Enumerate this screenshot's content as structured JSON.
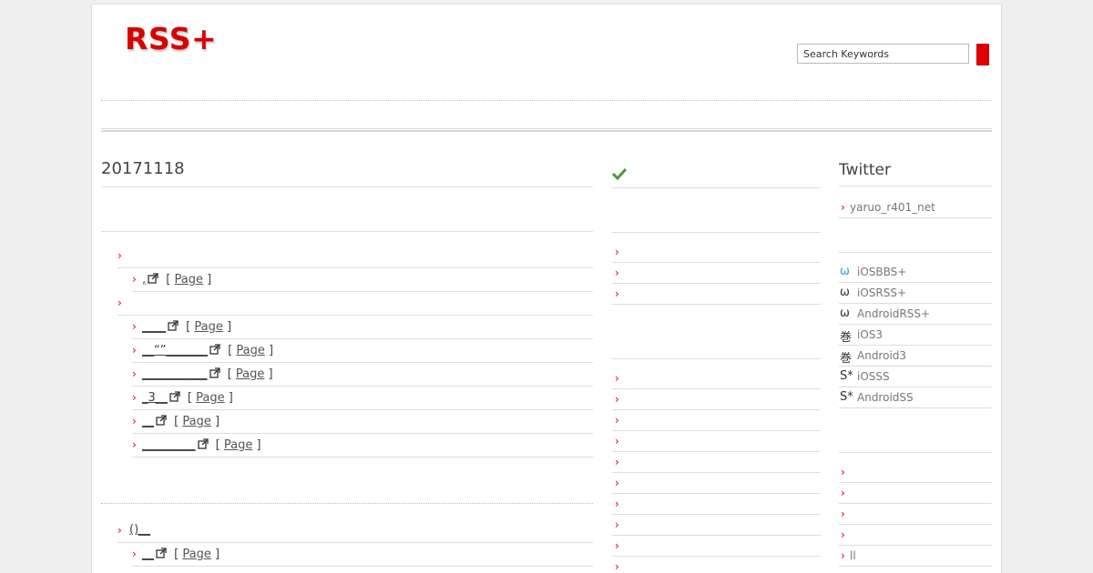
{
  "header": {
    "logo": "RSS+",
    "search_value": "Search Keywords"
  },
  "main": {
    "post_title": "20171118",
    "groups": [
      {
        "label": "",
        "items": [
          {
            "title": "",
            "page_label": "Page"
          }
        ]
      },
      {
        "label": "",
        "items": [
          {
            "title": "____",
            "page_label": "Page"
          },
          {
            "title": "__“”_______",
            "page_label": "Page"
          },
          {
            "title": "___________",
            "page_label": "Page"
          },
          {
            "title": "_3__",
            "page_label": "Page"
          },
          {
            "title": "__",
            "page_label": "Page"
          },
          {
            "title": "_________",
            "page_label": "Page"
          }
        ]
      }
    ],
    "second_group": {
      "label": "()__",
      "items": [
        {
          "title": "__",
          "page_label": "Page"
        }
      ]
    }
  },
  "middle": {
    "check_icon": "check-icon",
    "rows_a": [
      "",
      "",
      ""
    ],
    "rows_b": [
      "",
      "",
      "",
      "",
      "",
      "",
      "",
      "",
      "",
      ""
    ]
  },
  "right": {
    "twitter_title": "Twitter",
    "twitter_account": "yaruo_r401_net",
    "apps": [
      {
        "icon": "ω",
        "label": "iOSBBS+",
        "color": "#2a9ad4"
      },
      {
        "icon": "ω",
        "label": "iOSRSS+",
        "color": "#333333"
      },
      {
        "icon": "ω",
        "label": "AndroidRSS+",
        "color": "#333333"
      },
      {
        "icon": "巻",
        "label": "iOS3",
        "color": "#333333"
      },
      {
        "icon": "巻",
        "label": "Android3",
        "color": "#333333"
      },
      {
        "icon": "S*",
        "label": "iOSSS",
        "color": "#333333"
      },
      {
        "icon": "S*",
        "label": "AndroidSS",
        "color": "#333333"
      }
    ],
    "links": [
      "",
      "",
      "",
      "",
      "ll"
    ]
  },
  "colors": {
    "accent": "#d90000",
    "background": "#efefef"
  }
}
